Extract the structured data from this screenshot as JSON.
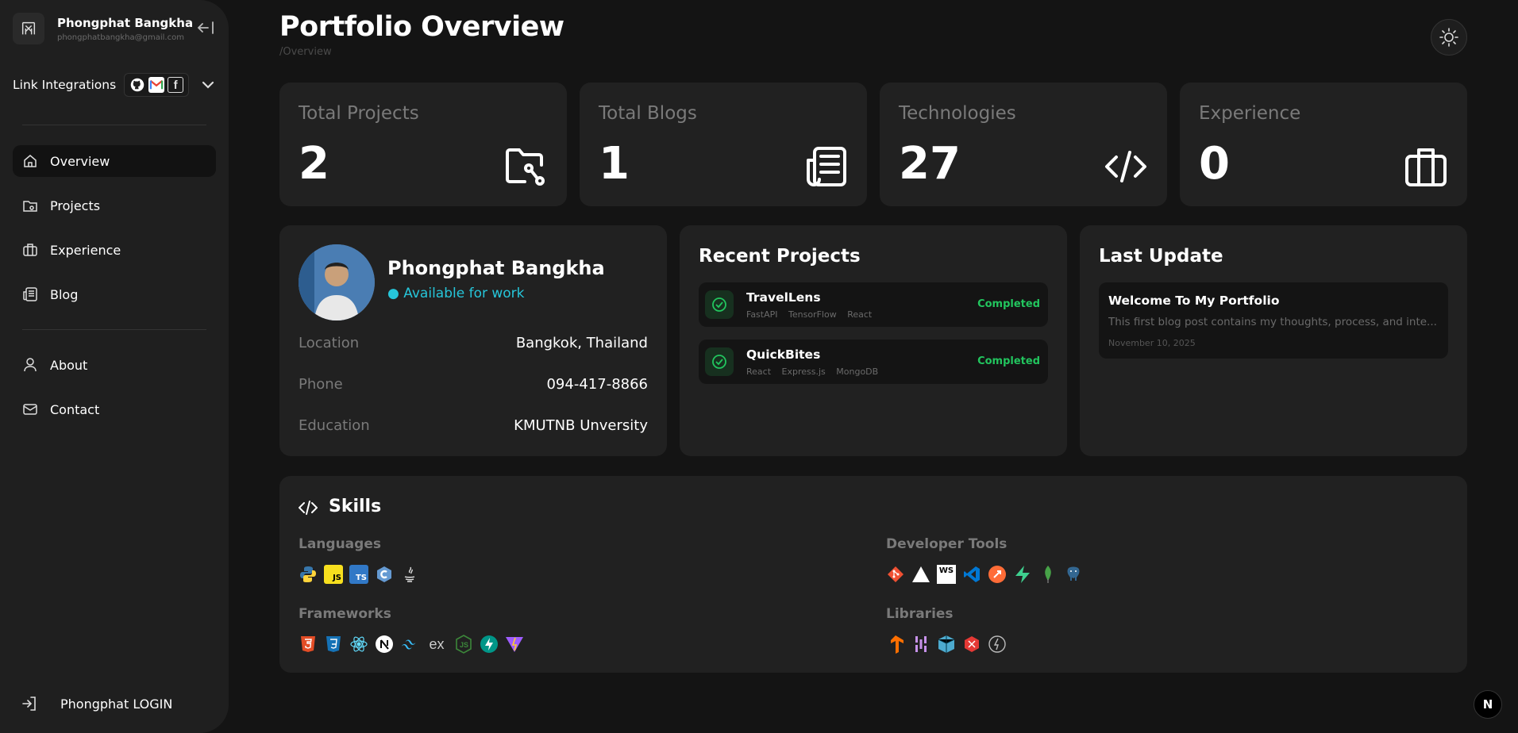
{
  "user": {
    "name": "Phongphat Bangkha",
    "email": "phongphatbangkha@gmail.com"
  },
  "integrations": {
    "label": "Link Integrations",
    "icons": [
      "github-icon",
      "gmail-icon",
      "facebook-icon"
    ]
  },
  "nav": {
    "overview": "Overview",
    "projects": "Projects",
    "experience": "Experience",
    "blog": "Blog",
    "about": "About",
    "contact": "Contact",
    "login": "Phongphat LOGIN"
  },
  "page": {
    "title": "Portfolio Overview",
    "breadcrumb": "/Overview"
  },
  "stats": [
    {
      "label": "Total Projects",
      "value": "2",
      "icon": "folder-link-icon"
    },
    {
      "label": "Total Blogs",
      "value": "1",
      "icon": "newspaper-icon"
    },
    {
      "label": "Technologies",
      "value": "27",
      "icon": "code-icon"
    },
    {
      "label": "Experience",
      "value": "0",
      "icon": "briefcase-icon"
    }
  ],
  "profile": {
    "name": "Phongphat Bangkha",
    "status": "● Available for work",
    "rows": [
      {
        "k": "Location",
        "v": "Bangkok, Thailand"
      },
      {
        "k": "Phone",
        "v": "094-417-8866"
      },
      {
        "k": "Education",
        "v": "KMUTNB Unversity"
      }
    ]
  },
  "recent": {
    "title": "Recent Projects",
    "items": [
      {
        "name": "TravelLens",
        "tags": [
          "FastAPI",
          "TensorFlow",
          "React"
        ],
        "status": "Completed"
      },
      {
        "name": "QuickBites",
        "tags": [
          "React",
          "Express.js",
          "MongoDB"
        ],
        "status": "Completed"
      }
    ]
  },
  "update": {
    "title": "Last Update",
    "post_title": "Welcome To My Portfolio",
    "excerpt": "This first blog post contains my thoughts, process, and inte...",
    "date": "November 10, 2025"
  },
  "skills": {
    "title": "Skills",
    "languages": "Languages",
    "frameworks": "Frameworks",
    "devtools": "Developer Tools",
    "libraries": "Libraries"
  },
  "colors": {
    "status_green": "#22c55e",
    "available_cyan": "#26c6da",
    "card_bg": "#212121",
    "page_bg": "#141414"
  }
}
